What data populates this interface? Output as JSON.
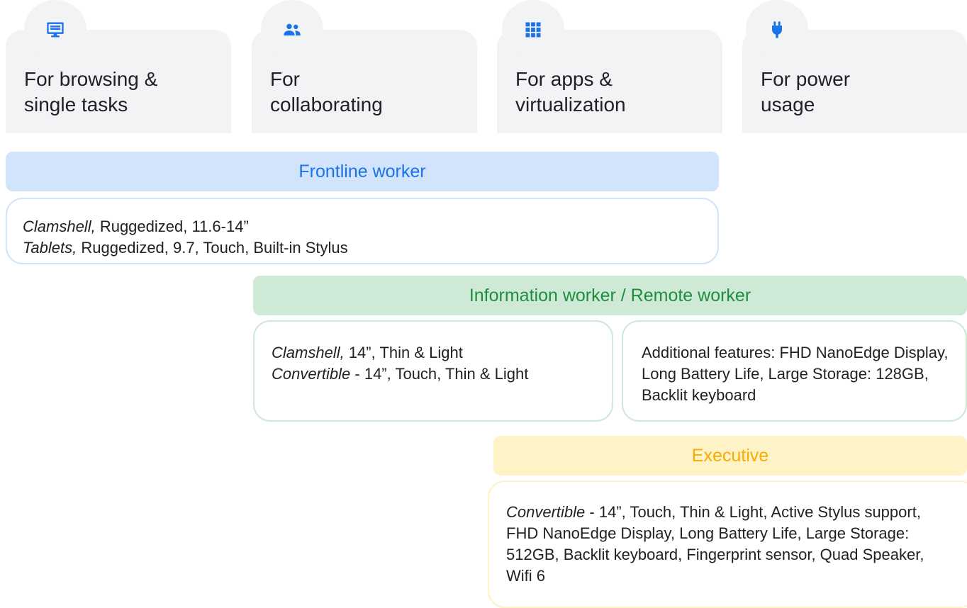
{
  "categories": [
    {
      "icon": "display-list-icon",
      "title": "For browsing &\nsingle tasks"
    },
    {
      "icon": "people-icon",
      "title": "For\ncollaborating"
    },
    {
      "icon": "apps-grid-icon",
      "title": "For apps &\nvirtualization"
    },
    {
      "icon": "power-plug-icon",
      "title": "For power\nusage"
    }
  ],
  "roles": {
    "frontline": {
      "label": "Frontline worker",
      "color": "#1a73e8",
      "bar_bg": "#d2e3fc",
      "lines": [
        {
          "type": "Clamshell,",
          "spec": " Ruggedized, 11.6-14”"
        },
        {
          "type": "Tablets,",
          "spec": " Ruggedized, 9.7, Touch, Built-in Stylus"
        }
      ]
    },
    "information": {
      "label": "Information worker / Remote worker",
      "color": "#1e8e3e",
      "bar_bg": "#ceead6",
      "lines": [
        {
          "type": "Clamshell,",
          "spec": " 14”, Thin & Light"
        },
        {
          "type": "Convertible",
          "spec": " - 14”, Touch, Thin & Light"
        }
      ],
      "additional": "Additional features: FHD NanoEdge Display, Long Battery Life, Large Storage: 128GB, Backlit keyboard"
    },
    "executive": {
      "label": "Executive",
      "color": "#f9ab00",
      "bar_bg": "#fef3c7",
      "lines": [
        {
          "type": "Convertible",
          "spec": " - 14”, Touch, Thin & Light, Active Stylus support, FHD NanoEdge Display, Long Battery Life, Large Storage: 512GB, Backlit keyboard, Fingerprint sensor, Quad Speaker, Wifi 6"
        }
      ]
    }
  }
}
